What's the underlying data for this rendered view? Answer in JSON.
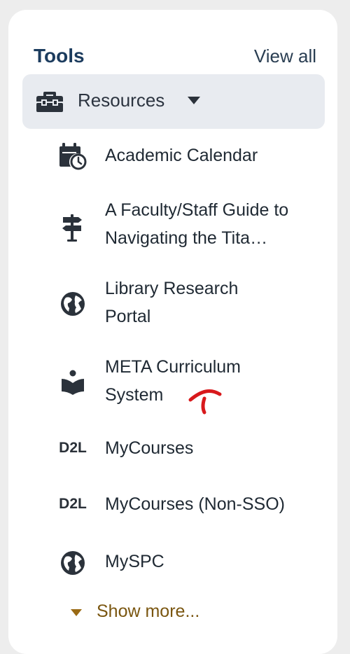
{
  "header": {
    "title": "Tools",
    "view_all": "View all"
  },
  "category": {
    "label": "Resources",
    "icon": "toolbox-icon",
    "expanded": true
  },
  "items": [
    {
      "label": "Academic Calendar",
      "icon": "calendar-clock-icon"
    },
    {
      "label": "A Faculty/Staff Guide to Navigating the Tita…",
      "icon": "signpost-icon"
    },
    {
      "label": "Library Research Portal",
      "icon": "globe-icon"
    },
    {
      "label": "META Curriculum System",
      "icon": "reading-person-icon"
    },
    {
      "label": "MyCourses",
      "icon": "d2l-icon",
      "icon_text": "D2L"
    },
    {
      "label": "MyCourses (Non-SSO)",
      "icon": "d2l-icon",
      "icon_text": "D2L"
    },
    {
      "label": "MySPC",
      "icon": "globe-icon"
    }
  ],
  "show_more": {
    "label": "Show more..."
  },
  "colors": {
    "title": "#1c3c5e",
    "category_bg": "#e8ebf0",
    "show_more": "#7a5610",
    "annotation": "#d8191c"
  }
}
